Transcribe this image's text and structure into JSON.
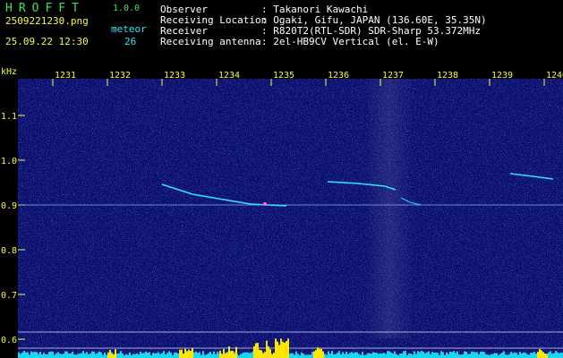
{
  "header": {
    "app_name": "HROFFT",
    "version": "1.0.0",
    "filename": "2509221230.png",
    "datetime": "25.09.22 12:30",
    "meteor_label": "meteor",
    "meteor_count": "26",
    "info_labels": [
      "Observer",
      "Receiving Location",
      "Receiver",
      "Receiving antenna"
    ],
    "info_values": [
      ": Takanori Kawachi",
      ": Ogaki, Gifu, JAPAN (136.60E, 35.35N)",
      ": R820T2(RTL-SDR) SDR-Sharp 53.372MHz",
      ": 2el-HB9CV Vertical (el. E-W)"
    ]
  },
  "spectrogram": {
    "y_unit": "kHz",
    "x_ticks": [
      "1231",
      "1232",
      "1233",
      "1234",
      "1235",
      "1236",
      "1237",
      "1238",
      "1239",
      "1240"
    ],
    "y_ticks": [
      "1.1",
      "1.0",
      "0.9",
      "0.8",
      "0.7",
      "0.6"
    ],
    "colors": {
      "background": "#0a0f6e",
      "tick_text": "#f7f74a",
      "echo": "#2de6ff",
      "carrier": "#8fb4ff",
      "baseline": "#ffe600",
      "noise_floor": "#19d7f0"
    }
  }
}
